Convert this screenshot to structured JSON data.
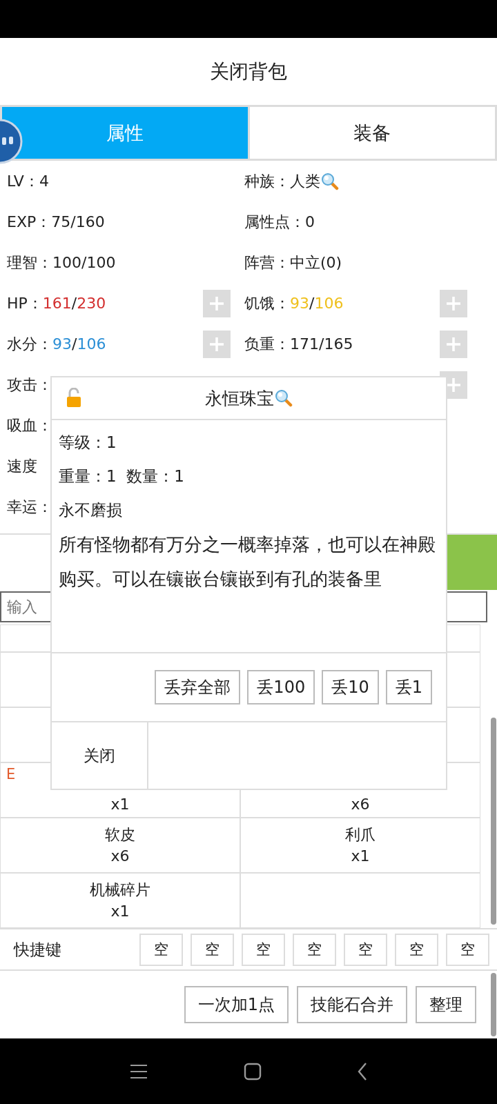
{
  "header": {
    "title": "关闭背包"
  },
  "tabs": [
    {
      "label": "属性",
      "selected": true
    },
    {
      "label": "装备",
      "selected": false
    }
  ],
  "stats": [
    {
      "kind": "stat",
      "label": "LV：",
      "value": "4"
    },
    {
      "kind": "stat",
      "label": "种族：",
      "value": "人类",
      "lookup": true
    },
    {
      "kind": "stat",
      "label": "EXP：",
      "value": "75/160"
    },
    {
      "kind": "stat",
      "label": "属性点：",
      "value": "0"
    },
    {
      "kind": "stat",
      "label": "理智：",
      "value": "100/100"
    },
    {
      "kind": "stat",
      "label": "阵营：",
      "value": "中立(0)"
    },
    {
      "kind": "stat",
      "label": "HP：",
      "current": "161",
      "sep": "/",
      "max": "230",
      "color": "#d32f2f",
      "plus": true
    },
    {
      "kind": "stat",
      "label": "饥饿：",
      "current": "93",
      "sep": "/",
      "max": "106",
      "color": "#efc01c",
      "plus": true
    },
    {
      "kind": "stat",
      "label": "水分：",
      "current": "93",
      "sep": "/",
      "max": "106",
      "color": "#2b8fd6",
      "plus": true
    },
    {
      "kind": "stat",
      "label": "负重：",
      "value": "171/165",
      "plus": true
    },
    {
      "kind": "stat",
      "label": "攻击："
    },
    {
      "kind": "stat",
      "plus": true
    },
    {
      "kind": "stat",
      "label": "吸血："
    },
    {
      "kind": "blank"
    },
    {
      "kind": "stat",
      "label": "速度"
    },
    {
      "kind": "blank"
    },
    {
      "kind": "stat",
      "label": "幸运："
    },
    {
      "kind": "blank"
    }
  ],
  "search": {
    "placeholder": "输入"
  },
  "items": [
    {
      "kind": "empty"
    },
    {
      "kind": "empty"
    },
    {
      "kind": "empty"
    },
    {
      "kind": "empty"
    },
    {
      "kind": "empty"
    },
    {
      "kind": "empty"
    },
    {
      "kind": "item",
      "tag": "E",
      "count": "x1"
    },
    {
      "kind": "item",
      "count": "x6"
    },
    {
      "kind": "item",
      "name": "软皮",
      "count": "x6"
    },
    {
      "kind": "item",
      "name": "利爪",
      "count": "x1"
    },
    {
      "kind": "item",
      "name": "机械碎片",
      "count": "x1"
    },
    {
      "kind": "empty"
    }
  ],
  "shortcuts": {
    "label": "快捷键",
    "slots": [
      "空",
      "空",
      "空",
      "空",
      "空",
      "空",
      "空"
    ]
  },
  "actions": [
    "一次加1点",
    "技能石合并",
    "整理"
  ],
  "dialog": {
    "locked": false,
    "title": "永恒珠宝",
    "lookup": true,
    "lines": [
      "等级：1",
      "重量：1  数量：1",
      "永不磨损"
    ],
    "description": "所有怪物都有万分之一概率掉落，也可以在神殿购买。可以在镶嵌台镶嵌到有孔的装备里",
    "buttons": [
      "丢弃全部",
      "丢100",
      "丢10",
      "丢1"
    ],
    "close": "关闭"
  }
}
